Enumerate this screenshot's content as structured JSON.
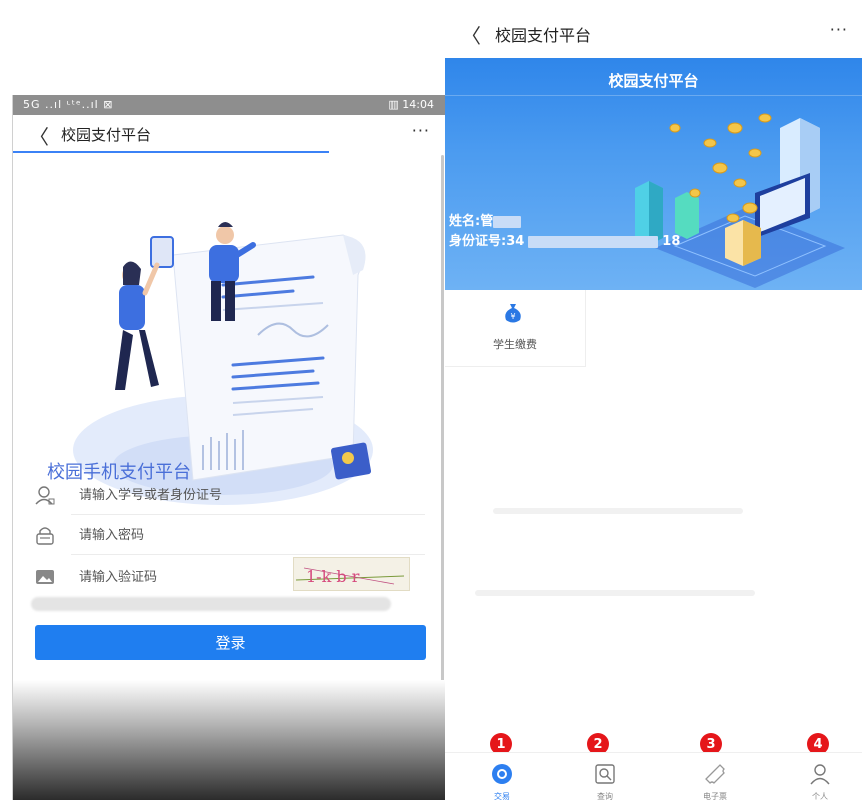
{
  "left_phone": {
    "status_bar": {
      "signal": "5G ..ıl ᶫᵗᵉ..ıl ⊠",
      "time": "14:04",
      "battery": "▥"
    },
    "titlebar": {
      "back": "〈",
      "title": "校园支付平台",
      "more": "···"
    },
    "login": {
      "heading": "校园手机支付平台",
      "user_placeholder": "请输入学号或者身份证号",
      "password_placeholder": "请输入密码",
      "captcha_placeholder": "请输入验证码",
      "captcha_text": "1-k b r",
      "login_button": "登录"
    }
  },
  "right_phone": {
    "titlebar": {
      "back": "〈",
      "title": "校园支付平台",
      "more": "···"
    },
    "banner": {
      "title": "校园支付平台",
      "name_label": "姓名:管",
      "id_label": "身份证号:34",
      "id_suffix": "18"
    },
    "grid": [
      {
        "label": "学生缴费",
        "icon": "money-bag-icon"
      }
    ],
    "tabs": [
      {
        "label": "交易",
        "icon": "home-icon",
        "badge": "1",
        "active": true
      },
      {
        "label": "查询",
        "icon": "search-icon",
        "badge": "2",
        "active": false
      },
      {
        "label": "电子票",
        "icon": "ticket-icon",
        "badge": "3",
        "active": false
      },
      {
        "label": "个人",
        "icon": "user-icon",
        "badge": "4",
        "active": false
      }
    ]
  },
  "colors": {
    "primary_blue": "#1f7ef0",
    "header_blue": "#2f86ea",
    "badge_red": "#e5161a",
    "heading_blue": "#4a6fd8"
  }
}
